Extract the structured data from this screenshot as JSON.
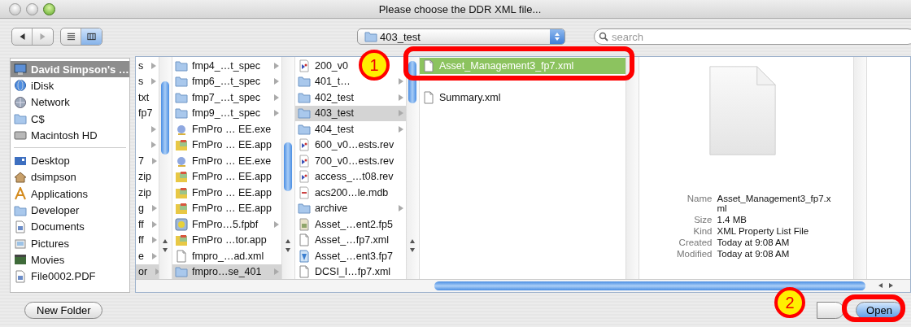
{
  "window": {
    "title": "Please choose the DDR XML file..."
  },
  "toolbar": {
    "back": {
      "disabled": false
    },
    "forward": {
      "disabled": true
    },
    "view_buttons": [
      {
        "kind": "list",
        "selected": false
      },
      {
        "kind": "columns",
        "selected": true
      }
    ],
    "location": "403_test",
    "search": {
      "placeholder": "search"
    }
  },
  "sidebar": {
    "sections": [
      {
        "items": [
          {
            "label": "David Simpson's …",
            "kind": "computer",
            "selected": true
          },
          {
            "label": "iDisk",
            "kind": "globe",
            "selected": false
          },
          {
            "label": "Network",
            "kind": "network",
            "selected": false
          },
          {
            "label": "C$",
            "kind": "folder",
            "selected": false
          },
          {
            "label": "Macintosh HD",
            "kind": "disk",
            "selected": false
          }
        ]
      },
      {
        "items": [
          {
            "label": "Desktop",
            "kind": "desktop",
            "selected": false
          },
          {
            "label": "dsimpson",
            "kind": "home",
            "selected": false
          },
          {
            "label": "Applications",
            "kind": "apps",
            "selected": false
          },
          {
            "label": "Developer",
            "kind": "folder",
            "selected": false
          },
          {
            "label": "Documents",
            "kind": "document",
            "selected": false
          },
          {
            "label": "Pictures",
            "kind": "pictures",
            "selected": false
          },
          {
            "label": "Movies",
            "kind": "movies",
            "selected": false
          },
          {
            "label": "File0002.PDF",
            "kind": "pdf",
            "selected": false
          }
        ]
      }
    ]
  },
  "columns": [
    {
      "active": false,
      "items": [
        {
          "name": "s",
          "kind": "none",
          "expandable": true,
          "selected": false
        },
        {
          "name": "s",
          "kind": "none",
          "expandable": true,
          "selected": false
        },
        {
          "name": "txt",
          "kind": "none",
          "expandable": false,
          "selected": false
        },
        {
          "name": "fp7",
          "kind": "none",
          "expandable": false,
          "selected": false
        },
        {
          "kind": "none",
          "expandable": true,
          "selected": false
        },
        {
          "kind": "none",
          "expandable": true,
          "selected": false
        },
        {
          "name": "7",
          "kind": "none",
          "expandable": true,
          "selected": false
        },
        {
          "name": "zip",
          "kind": "none",
          "expandable": false,
          "selected": false
        },
        {
          "name": "zip",
          "kind": "none",
          "expandable": false,
          "selected": false
        },
        {
          "name": "g",
          "kind": "none",
          "expandable": true,
          "selected": false
        },
        {
          "name": "ff",
          "kind": "none",
          "expandable": true,
          "selected": false
        },
        {
          "name": "ff",
          "kind": "none",
          "expandable": true,
          "selected": false
        },
        {
          "name": "e",
          "kind": "none",
          "expandable": true,
          "selected": false
        },
        {
          "name": "or",
          "kind": "none",
          "expandable": true,
          "selected": true
        }
      ]
    },
    {
      "active": false,
      "items": [
        {
          "name": "fmp4_…t_spec",
          "kind": "folder",
          "expandable": true,
          "selected": false
        },
        {
          "name": "fmp6_…t_spec",
          "kind": "folder",
          "expandable": true,
          "selected": false
        },
        {
          "name": "fmp7_…t_spec",
          "kind": "folder",
          "expandable": true,
          "selected": false
        },
        {
          "name": "fmp9_…t_spec",
          "kind": "folder",
          "expandable": true,
          "selected": false
        },
        {
          "name": "FmPro … EE.exe",
          "kind": "exe",
          "expandable": false,
          "selected": false
        },
        {
          "name": "FmPro … EE.app",
          "kind": "app",
          "expandable": false,
          "selected": false
        },
        {
          "name": "FmPro … EE.exe",
          "kind": "exe",
          "expandable": false,
          "selected": false
        },
        {
          "name": "FmPro … EE.app",
          "kind": "app",
          "expandable": false,
          "selected": false
        },
        {
          "name": "FmPro … EE.app",
          "kind": "app",
          "expandable": false,
          "selected": false
        },
        {
          "name": "FmPro … EE.app",
          "kind": "app",
          "expandable": false,
          "selected": false
        },
        {
          "name": "FmPro…5.fpbf",
          "kind": "package",
          "expandable": true,
          "selected": false
        },
        {
          "name": "FmPro …tor.app",
          "kind": "app",
          "expandable": false,
          "selected": false
        },
        {
          "name": "fmpro_…ad.xml",
          "kind": "document",
          "expandable": false,
          "selected": false
        },
        {
          "name": "fmpro…se_401",
          "kind": "folder",
          "expandable": true,
          "selected": true
        }
      ]
    },
    {
      "active": false,
      "items": [
        {
          "name": "200_v0",
          "kind": "rev",
          "expandable": false,
          "selected": false
        },
        {
          "name": "401_t…",
          "kind": "folder",
          "expandable": true,
          "selected": false
        },
        {
          "name": "402_test",
          "kind": "folder",
          "expandable": true,
          "selected": false
        },
        {
          "name": "403_test",
          "kind": "folder",
          "expandable": true,
          "selected": true
        },
        {
          "name": "404_test",
          "kind": "folder",
          "expandable": true,
          "selected": false
        },
        {
          "name": "600_v0…ests.rev",
          "kind": "rev",
          "expandable": false,
          "selected": false
        },
        {
          "name": "700_v0…ests.rev",
          "kind": "rev",
          "expandable": false,
          "selected": false
        },
        {
          "name": "access_…t08.rev",
          "kind": "rev",
          "expandable": false,
          "selected": false
        },
        {
          "name": "acs200…le.mdb",
          "kind": "database",
          "expandable": false,
          "selected": false
        },
        {
          "name": "archive",
          "kind": "folder",
          "expandable": true,
          "selected": false
        },
        {
          "name": "Asset_…ent2.fp5",
          "kind": "fp5",
          "expandable": false,
          "selected": false
        },
        {
          "name": "Asset_…fp7.xml",
          "kind": "document",
          "expandable": false,
          "selected": false
        },
        {
          "name": "Asset_…ent3.fp7",
          "kind": "fp7",
          "expandable": false,
          "selected": false
        },
        {
          "name": "DCSI_I…fp7.xml",
          "kind": "document",
          "expandable": false,
          "selected": false
        }
      ]
    },
    {
      "active": true,
      "items": [
        {
          "name": "Asset_Management3_fp7.xml",
          "kind": "document",
          "expandable": false,
          "selected": true
        },
        {
          "name": "Summary.xml",
          "kind": "document",
          "expandable": false,
          "selected": false
        }
      ]
    }
  ],
  "preview": {
    "fields": [
      {
        "label": "Name",
        "value": "Asset_Management3_fp7.xml"
      },
      {
        "label": "Size",
        "value": "1.4 MB"
      },
      {
        "label": "Kind",
        "value": "XML Property List File"
      },
      {
        "label": "Created",
        "value": "Today at 9:08 AM"
      },
      {
        "label": "Modified",
        "value": "Today at 9:08 AM"
      }
    ]
  },
  "buttons": {
    "new_folder": "New Folder",
    "open": "Open"
  },
  "annotations": [
    {
      "number": "1"
    },
    {
      "number": "2"
    }
  ]
}
